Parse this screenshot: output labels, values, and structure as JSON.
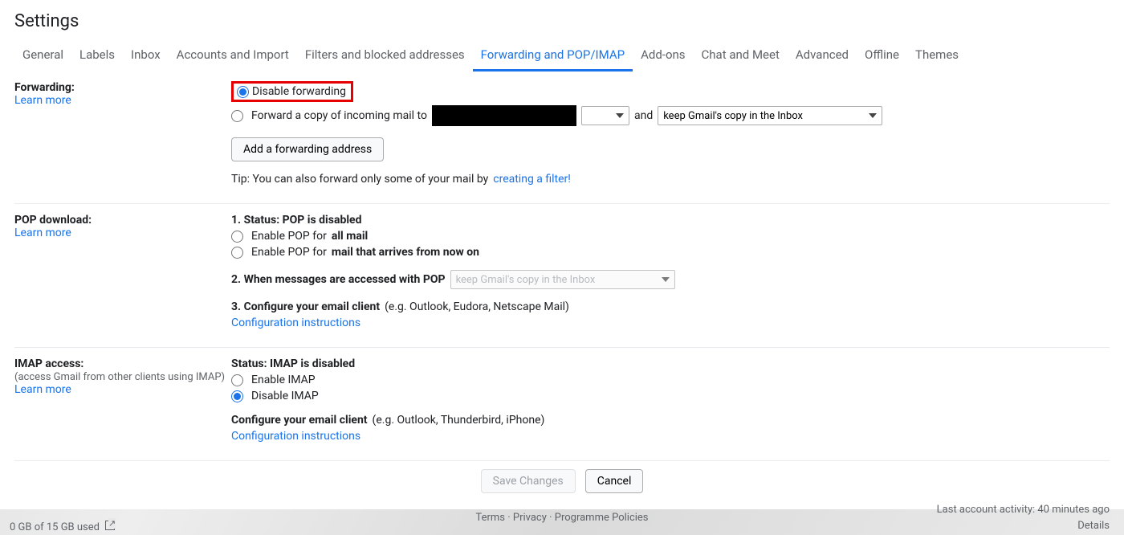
{
  "page_title": "Settings",
  "tabs": [
    {
      "label": "General"
    },
    {
      "label": "Labels"
    },
    {
      "label": "Inbox"
    },
    {
      "label": "Accounts and Import"
    },
    {
      "label": "Filters and blocked addresses"
    },
    {
      "label": "Forwarding and POP/IMAP",
      "active": true
    },
    {
      "label": "Add-ons"
    },
    {
      "label": "Chat and Meet"
    },
    {
      "label": "Advanced"
    },
    {
      "label": "Offline"
    },
    {
      "label": "Themes"
    }
  ],
  "forwarding": {
    "label": "Forwarding:",
    "learn_more": "Learn more",
    "radio_disable": "Disable forwarding",
    "radio_forward_prefix": "Forward a copy of incoming mail to",
    "and_text": "and",
    "keep_option": "keep Gmail's copy in the Inbox",
    "add_button": "Add a forwarding address",
    "tip_prefix": "Tip: You can also forward only some of your mail by ",
    "tip_link": "creating a filter!"
  },
  "pop": {
    "label": "POP download:",
    "learn_more": "Learn more",
    "status_prefix": "1. Status: ",
    "status_value": "POP is disabled",
    "enable_all_prefix": "Enable POP for ",
    "enable_all_bold": "all mail",
    "enable_now_prefix": "Enable POP for ",
    "enable_now_bold": "mail that arrives from now on",
    "step2": "2. When messages are accessed with POP",
    "step2_option": "keep Gmail's copy in the Inbox",
    "step3_bold": "3. Configure your email client ",
    "step3_rest": "(e.g. Outlook, Eudora, Netscape Mail)",
    "config_link": "Configuration instructions"
  },
  "imap": {
    "label": "IMAP access:",
    "sub": "(access Gmail from other clients using IMAP)",
    "learn_more": "Learn more",
    "status_prefix": "Status: ",
    "status_value": "IMAP is disabled",
    "enable": "Enable IMAP",
    "disable": "Disable IMAP",
    "config_bold": "Configure your email client ",
    "config_rest": "(e.g. Outlook, Thunderbird, iPhone)",
    "config_link": "Configuration instructions"
  },
  "buttons": {
    "save": "Save Changes",
    "cancel": "Cancel"
  },
  "footer": {
    "storage": "0 GB of 15 GB used",
    "terms": "Terms",
    "privacy": "Privacy",
    "policies": "Programme Policies",
    "activity": "Last account activity: 40 minutes ago",
    "details": "Details"
  }
}
